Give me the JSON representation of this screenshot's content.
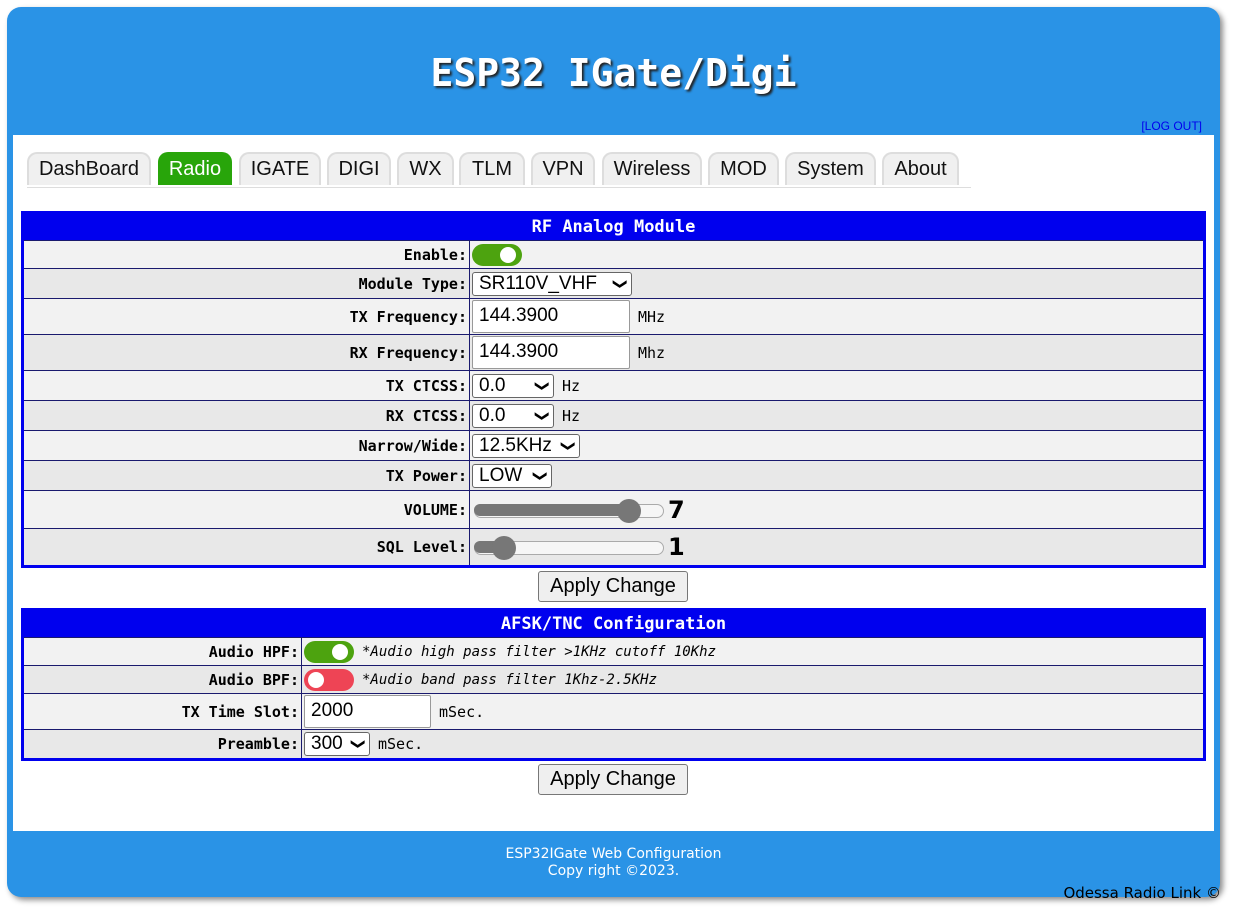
{
  "header": {
    "title": "ESP32 IGate/Digi",
    "logout_label": "[LOG OUT]"
  },
  "tabs": [
    {
      "label": "DashBoard",
      "active": false
    },
    {
      "label": "Radio",
      "active": true
    },
    {
      "label": "IGATE",
      "active": false
    },
    {
      "label": "DIGI",
      "active": false
    },
    {
      "label": "WX",
      "active": false
    },
    {
      "label": "TLM",
      "active": false
    },
    {
      "label": "VPN",
      "active": false
    },
    {
      "label": "Wireless",
      "active": false
    },
    {
      "label": "MOD",
      "active": false
    },
    {
      "label": "System",
      "active": false
    },
    {
      "label": "About",
      "active": false
    }
  ],
  "rf": {
    "title": "RF Analog Module",
    "enable": {
      "label": "Enable:",
      "on": true
    },
    "module_type": {
      "label": "Module Type:",
      "value": "SR110V_VHF"
    },
    "tx_freq": {
      "label": "TX Frequency:",
      "value": "144.3900",
      "unit": "MHz"
    },
    "rx_freq": {
      "label": "RX Frequency:",
      "value": "144.3900",
      "unit": "Mhz"
    },
    "tx_ctcss": {
      "label": "TX CTCSS:",
      "value": "0.0",
      "unit": "Hz"
    },
    "rx_ctcss": {
      "label": "RX CTCSS:",
      "value": "0.0",
      "unit": "Hz"
    },
    "narrow_wide": {
      "label": "Narrow/Wide:",
      "value": "12.5KHz"
    },
    "tx_power": {
      "label": "TX Power:",
      "value": "LOW"
    },
    "volume": {
      "label": "VOLUME:",
      "value": "7",
      "level": 0.86
    },
    "sql": {
      "label": "SQL Level:",
      "value": "1",
      "level": 0.11
    },
    "apply_label": "Apply Change"
  },
  "afsk": {
    "title": "AFSK/TNC Configuration",
    "hpf": {
      "label": "Audio HPF:",
      "on": true,
      "note": "*Audio high pass filter >1KHz cutoff 10Khz"
    },
    "bpf": {
      "label": "Audio BPF:",
      "on": false,
      "note": "*Audio band pass filter 1Khz-2.5KHz"
    },
    "tx_time_slot": {
      "label": "TX Time Slot:",
      "value": "2000",
      "unit": "mSec."
    },
    "preamble": {
      "label": "Preamble:",
      "value": "300",
      "unit": "mSec."
    },
    "apply_label": "Apply Change"
  },
  "footer": {
    "line1": "ESP32IGate Web Configuration",
    "line2": "Copy right ©2023.",
    "credit": "Odessa Radio Link ©"
  }
}
